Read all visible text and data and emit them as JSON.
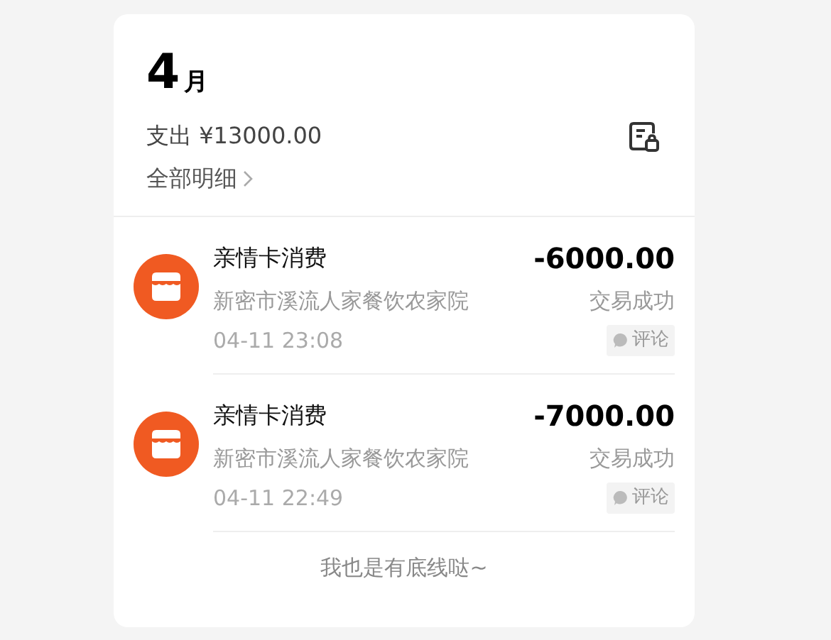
{
  "header": {
    "month_number": "4",
    "month_unit": "月",
    "expense": "支出 ¥13000.00",
    "details_link": "全部明细"
  },
  "transactions": [
    {
      "title": "亲情卡消费",
      "merchant": "新密市溪流人家餐饮农家院",
      "time": "04-11 23:08",
      "amount": "-6000.00",
      "status": "交易成功",
      "comment": "评论"
    },
    {
      "title": "亲情卡消费",
      "merchant": "新密市溪流人家餐饮农家院",
      "time": "04-11 22:49",
      "amount": "-7000.00",
      "status": "交易成功",
      "comment": "评论"
    }
  ],
  "footer": "我也是有底线哒~"
}
